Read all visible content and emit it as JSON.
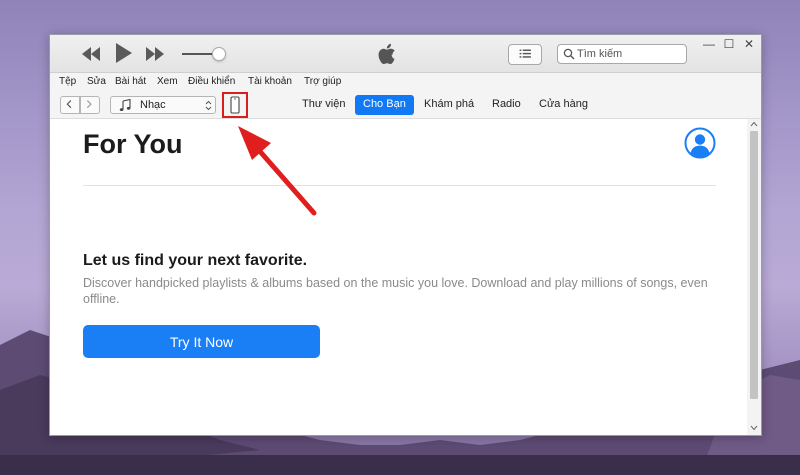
{
  "menu": [
    "Tệp",
    "Sửa",
    "Bài hát",
    "Xem",
    "Điều khiển",
    "Tài khoản",
    "Trợ giúp"
  ],
  "search": {
    "placeholder": "Tìm kiếm"
  },
  "window_controls": {
    "minimize": "—",
    "maximize": "☐",
    "close": "✕"
  },
  "media_selector": {
    "label": "Nhạc"
  },
  "tabs": [
    {
      "label": "Thư viện",
      "active": false
    },
    {
      "label": "Cho Bạn",
      "active": true
    },
    {
      "label": "Khám phá",
      "active": false
    },
    {
      "label": "Radio",
      "active": false
    },
    {
      "label": "Cửa hàng",
      "active": false
    }
  ],
  "main": {
    "title": "For You",
    "promo_heading": "Let us find your next favorite.",
    "promo_body": "Discover handpicked playlists & albums based on the music you love. Download and play millions of songs, even offline.",
    "try_button": "Try It Now"
  },
  "colors": {
    "accent": "#1a7ff5",
    "highlight": "#d81e1e",
    "account_icon": "#1a7ff5"
  },
  "icons": {
    "device": "iphone-icon",
    "apple": "apple-logo-icon",
    "account": "account-icon"
  }
}
